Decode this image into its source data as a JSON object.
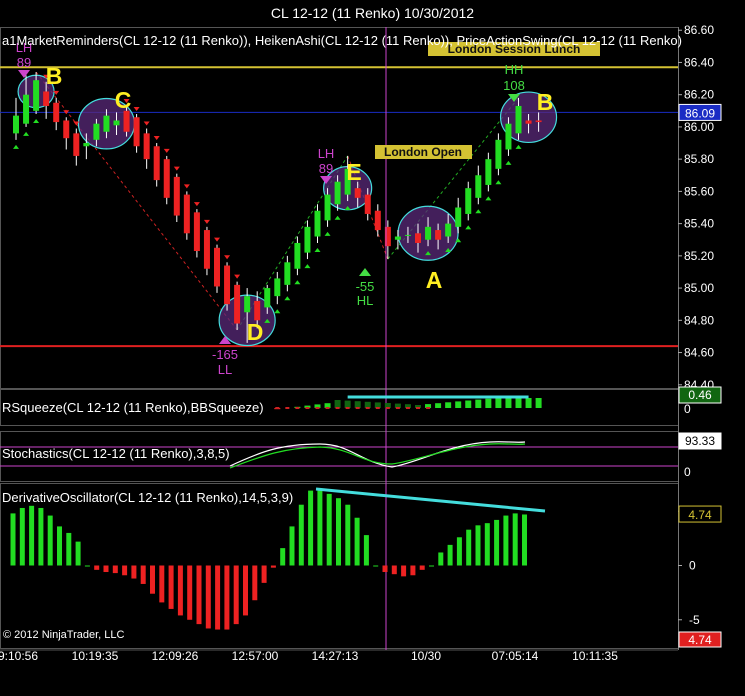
{
  "window": {
    "title": "CL 12-12 (11 Renko)  10/30/2012"
  },
  "panel_labels": {
    "price": "a1MarketReminders(CL 12-12 (11 Renko)), HeikenAshi(CL 12-12 (11 Renko)), PriceActionSwing(CL 12-12 (11 Renko)",
    "squeeze": "RSqueeze(CL 12-12 (11 Renko),BBSqueeze)",
    "stoch": "Stochastics(CL 12-12 (11 Renko),3,8,5)",
    "deriv": "DerivativeOscillator(CL 12-12 (11 Renko),14,5,3,9)"
  },
  "copyright": "© 2012 NinjaTrader, LLC",
  "session_boxes": {
    "lunch": "London Session Lunch",
    "open": "London Open"
  },
  "colors": {
    "bull": "#22dd22",
    "bear": "#ee2222",
    "gold_line": "#d4c233",
    "red_line": "#e02020",
    "blue_line": "#1a2cc4",
    "cursor": "#cc44cc",
    "cyan": "#44dddd",
    "label_yellow": "#ffee22",
    "swing_magenta": "#cc44cc",
    "swing_green": "#44dd44",
    "axis_text": "#ffffff"
  },
  "chart_data": [
    {
      "type": "candlestick",
      "panel": "price",
      "ylim": [
        84.38,
        86.62
      ],
      "y_ticks": [
        "86.60",
        "86.40",
        "86.20",
        "86.00",
        "85.80",
        "85.60",
        "85.40",
        "85.20",
        "85.00",
        "84.80",
        "84.60",
        "84.40"
      ],
      "y_tick_values": [
        86.6,
        86.4,
        86.2,
        86.0,
        85.8,
        85.6,
        85.4,
        85.2,
        85.0,
        84.8,
        84.6,
        84.4
      ],
      "current_price_label": "86.09",
      "current_price": 86.09,
      "horizontal_lines": {
        "gold": 86.37,
        "red": 84.64,
        "blue": 86.09
      },
      "candles": [
        {
          "o": 85.96,
          "c": 86.07,
          "h": 86.18,
          "l": 85.92
        },
        {
          "o": 86.02,
          "c": 86.2,
          "h": 86.32,
          "l": 86.0
        },
        {
          "o": 86.1,
          "c": 86.29,
          "h": 86.34,
          "l": 86.08
        },
        {
          "o": 86.22,
          "c": 86.13,
          "h": 86.28,
          "l": 86.05
        },
        {
          "o": 86.15,
          "c": 86.03,
          "h": 86.18,
          "l": 85.98
        },
        {
          "o": 86.04,
          "c": 85.93,
          "h": 86.06,
          "l": 85.86
        },
        {
          "o": 85.96,
          "c": 85.82,
          "h": 85.99,
          "l": 85.76
        },
        {
          "o": 85.88,
          "c": 85.9,
          "h": 85.96,
          "l": 85.8
        },
        {
          "o": 85.92,
          "c": 86.02,
          "h": 86.05,
          "l": 85.88
        },
        {
          "o": 85.97,
          "c": 86.07,
          "h": 86.11,
          "l": 85.93
        },
        {
          "o": 86.01,
          "c": 86.04,
          "h": 86.09,
          "l": 85.95
        },
        {
          "o": 86.1,
          "c": 85.97,
          "h": 86.13,
          "l": 85.94
        },
        {
          "o": 86.06,
          "c": 85.88,
          "h": 86.08,
          "l": 85.84
        },
        {
          "o": 85.96,
          "c": 85.8,
          "h": 85.99,
          "l": 85.74
        },
        {
          "o": 85.88,
          "c": 85.67,
          "h": 85.9,
          "l": 85.63
        },
        {
          "o": 85.8,
          "c": 85.56,
          "h": 85.82,
          "l": 85.52
        },
        {
          "o": 85.69,
          "c": 85.45,
          "h": 85.71,
          "l": 85.41
        },
        {
          "o": 85.58,
          "c": 85.34,
          "h": 85.6,
          "l": 85.3
        },
        {
          "o": 85.47,
          "c": 85.23,
          "h": 85.49,
          "l": 85.19
        },
        {
          "o": 85.36,
          "c": 85.12,
          "h": 85.38,
          "l": 85.08
        },
        {
          "o": 85.25,
          "c": 85.01,
          "h": 85.27,
          "l": 84.97
        },
        {
          "o": 85.14,
          "c": 84.9,
          "h": 85.16,
          "l": 84.86
        },
        {
          "o": 85.02,
          "c": 84.78,
          "h": 85.04,
          "l": 84.74
        },
        {
          "o": 84.85,
          "c": 84.95,
          "h": 85.0,
          "l": 84.66
        },
        {
          "o": 84.92,
          "c": 84.8,
          "h": 84.98,
          "l": 84.75
        },
        {
          "o": 84.88,
          "c": 85.0,
          "h": 85.02,
          "l": 84.84
        },
        {
          "o": 84.95,
          "c": 85.06,
          "h": 85.1,
          "l": 84.9
        },
        {
          "o": 85.02,
          "c": 85.16,
          "h": 85.2,
          "l": 84.98
        },
        {
          "o": 85.12,
          "c": 85.28,
          "h": 85.32,
          "l": 85.08
        },
        {
          "o": 85.22,
          "c": 85.38,
          "h": 85.42,
          "l": 85.18
        },
        {
          "o": 85.32,
          "c": 85.48,
          "h": 85.52,
          "l": 85.28
        },
        {
          "o": 85.42,
          "c": 85.58,
          "h": 85.62,
          "l": 85.38
        },
        {
          "o": 85.52,
          "c": 85.66,
          "h": 85.7,
          "l": 85.48
        },
        {
          "o": 85.58,
          "c": 85.74,
          "h": 85.82,
          "l": 85.54
        },
        {
          "o": 85.62,
          "c": 85.56,
          "h": 85.66,
          "l": 85.5
        },
        {
          "o": 85.58,
          "c": 85.46,
          "h": 85.62,
          "l": 85.42
        },
        {
          "o": 85.48,
          "c": 85.36,
          "h": 85.52,
          "l": 85.32
        },
        {
          "o": 85.38,
          "c": 85.26,
          "h": 85.42,
          "l": 85.18
        },
        {
          "o": 85.3,
          "c": 85.32,
          "h": 85.36,
          "l": 85.24
        },
        {
          "o": 85.33,
          "c": 85.33,
          "h": 85.38,
          "l": 85.28
        },
        {
          "o": 85.34,
          "c": 85.28,
          "h": 85.4,
          "l": 85.22
        },
        {
          "o": 85.3,
          "c": 85.38,
          "h": 85.44,
          "l": 85.26
        },
        {
          "o": 85.36,
          "c": 85.3,
          "h": 85.4,
          "l": 85.24
        },
        {
          "o": 85.32,
          "c": 85.4,
          "h": 85.46,
          "l": 85.28
        },
        {
          "o": 85.38,
          "c": 85.5,
          "h": 85.56,
          "l": 85.34
        },
        {
          "o": 85.46,
          "c": 85.62,
          "h": 85.66,
          "l": 85.42
        },
        {
          "o": 85.56,
          "c": 85.7,
          "h": 85.76,
          "l": 85.52
        },
        {
          "o": 85.64,
          "c": 85.8,
          "h": 85.84,
          "l": 85.6
        },
        {
          "o": 85.74,
          "c": 85.92,
          "h": 85.96,
          "l": 85.7
        },
        {
          "o": 85.86,
          "c": 86.02,
          "h": 86.06,
          "l": 85.82
        },
        {
          "o": 85.96,
          "c": 86.13,
          "h": 86.18,
          "l": 85.92
        },
        {
          "o": 86.04,
          "c": 86.02,
          "h": 86.08,
          "l": 85.96
        },
        {
          "o": 86.04,
          "c": 86.03,
          "h": 86.09,
          "l": 85.97
        }
      ],
      "x_tick_labels": [
        "9:10:56",
        "10:19:35",
        "12:09:26",
        "12:57:00",
        "14:27:13",
        "10/30",
        "07:05:14",
        "10:11:35"
      ]
    },
    {
      "type": "histogram",
      "panel": "squeeze",
      "y_label": "0.46",
      "y_tick_label": "0"
    },
    {
      "type": "line",
      "panel": "stoch",
      "y_label": "93.33",
      "y_tick_label": "0"
    },
    {
      "type": "bar",
      "panel": "deriv",
      "ylim": [
        -7.6,
        7.6
      ],
      "y_ticks": [
        "5",
        "0",
        "-5"
      ],
      "y_tick_values": [
        5,
        0,
        -5
      ],
      "last_value_label": "4.74",
      "low_value_label": "4.74",
      "values": [
        4.8,
        5.3,
        5.5,
        5.3,
        4.6,
        3.6,
        3.0,
        2.2,
        0.0,
        -0.4,
        -0.6,
        -0.7,
        -0.9,
        -1.2,
        -1.7,
        -2.6,
        -3.4,
        -4.0,
        -4.6,
        -5.0,
        -5.4,
        -5.8,
        -5.9,
        -5.9,
        -5.4,
        -4.6,
        -3.2,
        -1.6,
        -0.2,
        1.6,
        3.6,
        5.6,
        6.9,
        6.9,
        6.6,
        6.2,
        5.6,
        4.4,
        2.8,
        0.0,
        -0.6,
        -0.8,
        -1.0,
        -0.9,
        -0.4,
        0.0,
        1.2,
        1.9,
        2.6,
        3.3,
        3.7,
        3.9,
        4.2,
        4.6,
        4.8,
        4.7
      ]
    }
  ],
  "annotations": {
    "letters": [
      "B",
      "C",
      "D",
      "E",
      "A",
      "B"
    ],
    "swings": {
      "lh1_top": "LH",
      "lh1_bot": "89",
      "lh2_top": "LH",
      "lh2_bot": "89",
      "ll_top": "-165",
      "ll_bot": "LL",
      "hl_top": "-55",
      "hl_bot": "HL",
      "hh_top": "HH",
      "hh_bot": "108"
    }
  }
}
